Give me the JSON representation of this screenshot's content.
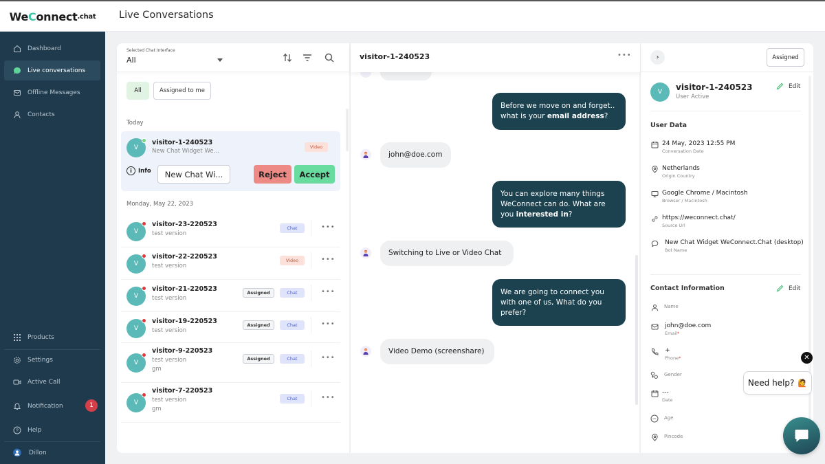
{
  "app": {
    "logo": {
      "pre": "We",
      "c": "C",
      "post": "onnect",
      "suffix": ".chat"
    },
    "page_title": "Live Conversations"
  },
  "sidebar": {
    "items": [
      {
        "label": "Dashboard",
        "icon": "home-icon"
      },
      {
        "label": "Live conversations",
        "icon": "chat-bubble-icon",
        "active": true
      },
      {
        "label": "Offline Messages",
        "icon": "mail-icon"
      },
      {
        "label": "Contacts",
        "icon": "user-icon"
      }
    ],
    "bottom_items": [
      {
        "label": "Products",
        "icon": "grid-icon"
      },
      {
        "label": "Settings",
        "icon": "gear-icon"
      },
      {
        "label": "Active Call",
        "icon": "video-camera-icon"
      },
      {
        "label": "Notification",
        "icon": "bell-icon",
        "badge": "1"
      },
      {
        "label": "Help",
        "icon": "help-icon"
      }
    ],
    "user": {
      "name": "Dillon"
    }
  },
  "list": {
    "selector_label": "Selected Chat Interface",
    "selector_value": "All",
    "filters": {
      "all": "All",
      "assigned_to_me": "Assigned to me"
    },
    "section_today": "Today",
    "active_conversation": {
      "avatar": "V",
      "name": "visitor-1-240523",
      "subtitle": "New Chat Widget We...",
      "tag": "Video",
      "info_label": "Info",
      "widget_button": "New Chat Wi...",
      "reject": "Reject",
      "accept": "Accept"
    },
    "section_date": "Monday, May 22, 2023",
    "conversations": [
      {
        "avatar": "V",
        "name": "visitor-23-220523",
        "sub": "test version",
        "sub2": "",
        "assigned": "",
        "tag": "Chat",
        "tag_type": "chat"
      },
      {
        "avatar": "V",
        "name": "visitor-22-220523",
        "sub": "test version",
        "sub2": "",
        "assigned": "",
        "tag": "Video",
        "tag_type": "video"
      },
      {
        "avatar": "V",
        "name": "visitor-21-220523",
        "sub": "test version",
        "sub2": "",
        "assigned": "Assigned",
        "tag": "Chat",
        "tag_type": "chat"
      },
      {
        "avatar": "V",
        "name": "visitor-19-220523",
        "sub": "test version",
        "sub2": "",
        "assigned": "Assigned",
        "tag": "Chat",
        "tag_type": "chat"
      },
      {
        "avatar": "V",
        "name": "visitor-9-220523",
        "sub": "test version",
        "sub2": "gm",
        "assigned": "Assigned",
        "tag": "Chat",
        "tag_type": "chat"
      },
      {
        "avatar": "V",
        "name": "visitor-7-220523",
        "sub": "test version",
        "sub2": "gm",
        "assigned": "",
        "tag": "Chat",
        "tag_type": "chat"
      }
    ],
    "more_label": "•••"
  },
  "chat": {
    "title": "visitor-1-240523",
    "more_label": "•••",
    "messages": [
      {
        "dir": "out",
        "text": "Before we move on and forget.. what is your ",
        "bold": "email address",
        "after": "?"
      },
      {
        "dir": "in",
        "text": "john@doe.com"
      },
      {
        "dir": "out",
        "text": "You can explore many things WeConnect can do. What are you ",
        "bold": "interested in",
        "after": "?"
      },
      {
        "dir": "in",
        "text": "Switching to Live or Video Chat"
      },
      {
        "dir": "out",
        "text": "We are going to connect you with one of us, What do you prefer?",
        "bold": "",
        "after": ""
      },
      {
        "dir": "in",
        "text": "Video Demo (screenshare)"
      }
    ]
  },
  "info": {
    "collapse_icon": "›",
    "assigned_button": "Assigned",
    "avatar": "V",
    "name": "visitor-1-240523",
    "status": "User Active",
    "edit_label": "Edit",
    "user_data_title": "User Data",
    "user_data": [
      {
        "icon": "calendar-icon",
        "value": "24 May, 2023 12:55 PM",
        "label": "Conversation Date"
      },
      {
        "icon": "location-icon",
        "value": "Netherlands",
        "label": "Origin Country"
      },
      {
        "icon": "monitor-icon",
        "value": "Google Chrome / Macintosh",
        "label": "Browser / Macintosh"
      },
      {
        "icon": "link-icon",
        "value": "https://weconnect.chat/",
        "label": "Source Url"
      },
      {
        "icon": "comment-icon",
        "value": "New Chat Widget WeConnect.Chat (desktop)",
        "label": "Bot Name"
      }
    ],
    "contact_title": "Contact Information",
    "contact": {
      "name_label": "Name",
      "email_value": "john@doe.com",
      "email_label": "Email",
      "phone_value": "+",
      "phone_label": "Phone",
      "required_mark": "*",
      "gender_label": "Gender",
      "date_value": "---",
      "date_label": "Date",
      "age_label": "Age",
      "pincode_label": "Pincode"
    }
  },
  "widget": {
    "close": "✕",
    "help_text": "Need help?",
    "help_emoji": "🙋"
  },
  "colors": {
    "sidebar_bg": "#1f3a4d",
    "accent_green": "#3dc6a8",
    "outgoing_bubble": "#1c4250",
    "avatar": "#5bbab7",
    "reject": "#ee8a86",
    "accept": "#68db9e"
  }
}
